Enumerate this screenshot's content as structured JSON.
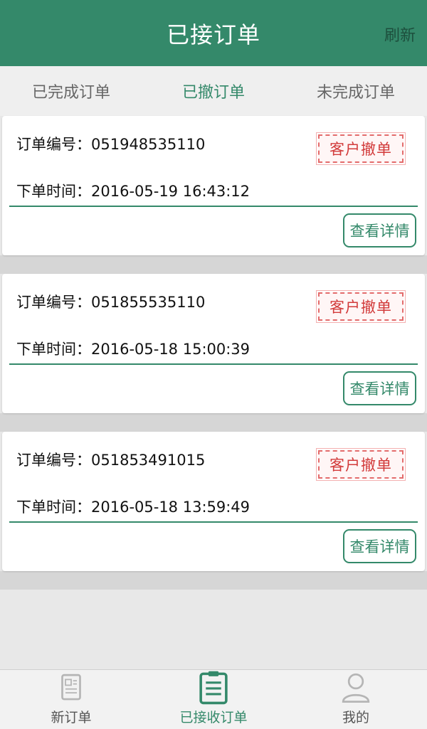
{
  "header": {
    "title": "已接订单",
    "refresh_label": "刷新"
  },
  "tabs": [
    {
      "label": "已完成订单",
      "active": false
    },
    {
      "label": "已撤订单",
      "active": true
    },
    {
      "label": "未完成订单",
      "active": false
    }
  ],
  "orders": [
    {
      "id_label": "订单编号：051948535110",
      "time_label": "下单时间：2016-05-19 16:43:12",
      "stamp": "客户撤单",
      "detail_label": "查看详情"
    },
    {
      "id_label": "订单编号：051855535110",
      "time_label": "下单时间：2016-05-18 15:00:39",
      "stamp": "客户撤单",
      "detail_label": "查看详情"
    },
    {
      "id_label": "订单编号：051853491015",
      "time_label": "下单时间：2016-05-18 13:59:49",
      "stamp": "客户撤单",
      "detail_label": "查看详情"
    }
  ],
  "bottom_nav": [
    {
      "label": "新订单",
      "icon": "new-order-icon"
    },
    {
      "label": "已接收订单",
      "icon": "clipboard-icon"
    },
    {
      "label": "我的",
      "icon": "user-icon"
    }
  ],
  "colors": {
    "accent": "#34896a",
    "stamp": "#d23b3b"
  }
}
